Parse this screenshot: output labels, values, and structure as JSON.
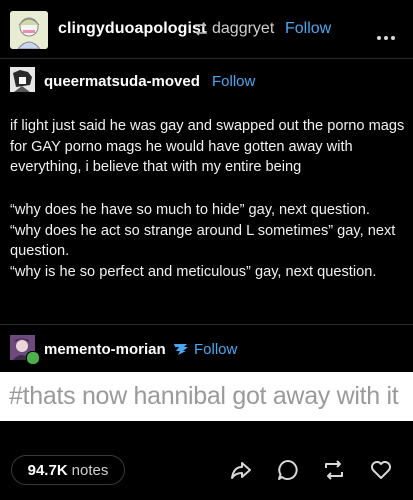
{
  "header": {
    "username": "clingyduoapologist",
    "reblogged_from": "daggryet",
    "follow_label": "Follow",
    "icons": [
      "avatar",
      "reblog-icon",
      "more-options-icon"
    ]
  },
  "trail": [
    {
      "username": "queermatsuda-moved",
      "follow_label": "Follow",
      "paragraphs": [
        "if light just said he was gay and swapped out the porno mags for GAY porno mags he would have gotten away with everything, i believe that with my entire being",
        "“why does he have so much to hide” gay, next question.\n“why does he act so strange around L sometimes” gay, next question.\n“why is he so perfect and meticulous” gay, next question."
      ]
    },
    {
      "username": "memento-morian",
      "follow_label": "Follow",
      "tag_image_text": "#thats now hannibal got away with it"
    }
  ],
  "footer": {
    "notes_count": "94.7K",
    "notes_label": "notes",
    "actions": [
      "share-icon",
      "reply-icon",
      "reblog-icon",
      "like-icon"
    ]
  },
  "colors": {
    "background": "#000000",
    "link": "#4aa7f0",
    "text": "#f2f2f2",
    "tag_box": "#ffffff"
  }
}
